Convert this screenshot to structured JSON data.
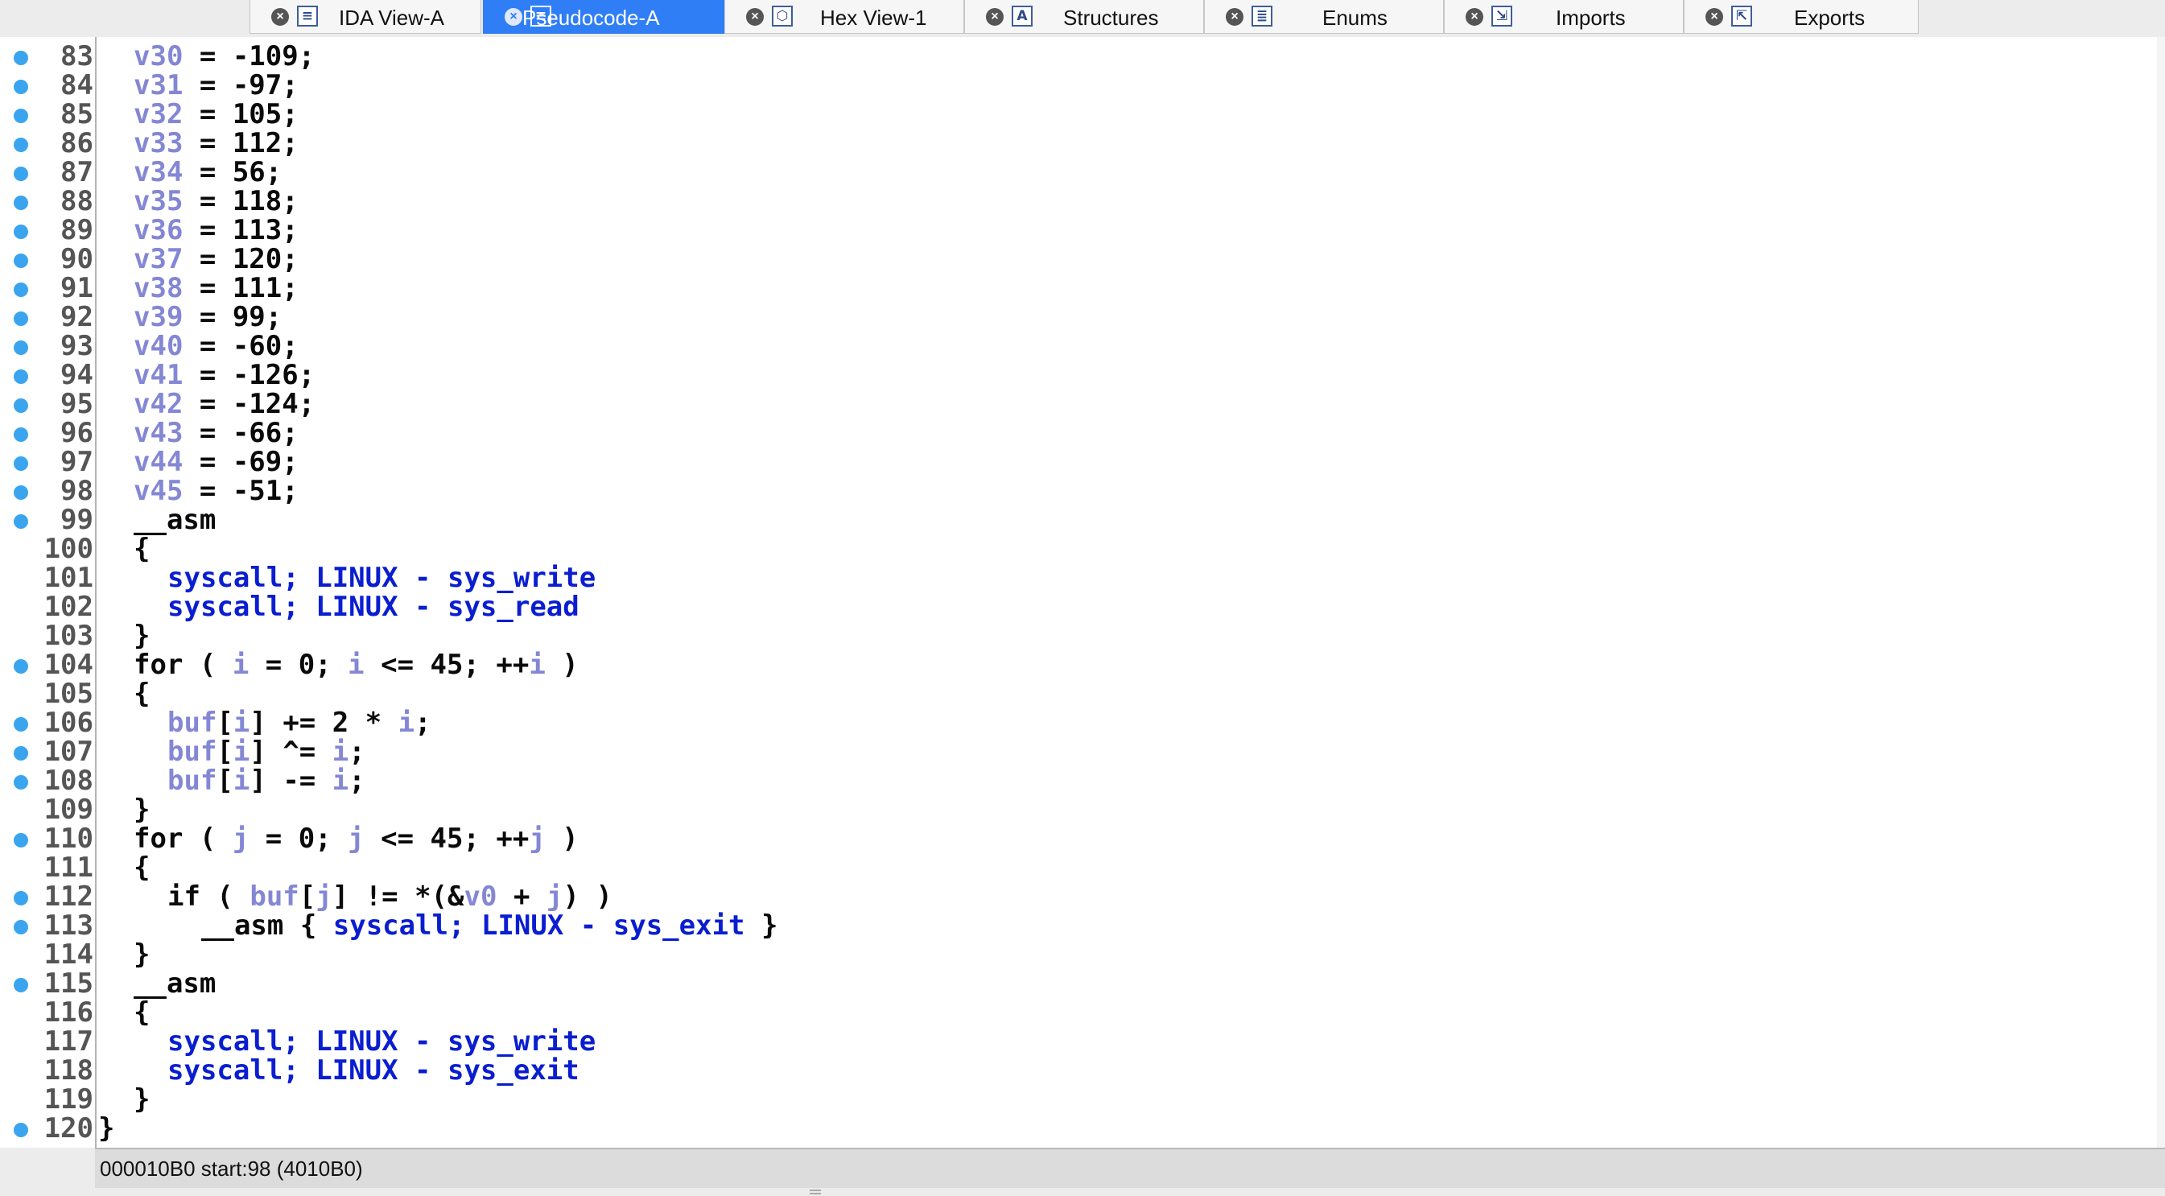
{
  "tabs": [
    {
      "label": "IDA View-A",
      "icon": "disassembly-icon",
      "glyph": "≡",
      "active": false
    },
    {
      "label": "Pseudocode-A",
      "icon": "pseudocode-icon",
      "glyph": "≡",
      "active": true
    },
    {
      "label": "Hex View-1",
      "icon": "hex-icon",
      "glyph": "⬡",
      "active": false
    },
    {
      "label": "Structures",
      "icon": "structures-icon",
      "glyph": "A",
      "active": false
    },
    {
      "label": "Enums",
      "icon": "enums-icon",
      "glyph": "≣",
      "active": false
    },
    {
      "label": "Imports",
      "icon": "imports-icon",
      "glyph": "⇲",
      "active": false
    },
    {
      "label": "Exports",
      "icon": "exports-icon",
      "glyph": "⇱",
      "active": false
    }
  ],
  "colors": {
    "variable": "#8487d4",
    "asm_text": "#0a1ed0",
    "breakpoint_dot": "#3aa5ee",
    "active_tab": "#2f7ef6"
  },
  "lines": [
    {
      "n": "83",
      "dot": true,
      "indent": 1,
      "segs": [
        [
          "v30",
          "var"
        ],
        [
          " = -109;",
          ""
        ]
      ]
    },
    {
      "n": "84",
      "dot": true,
      "indent": 1,
      "segs": [
        [
          "v31",
          "var"
        ],
        [
          " = -97;",
          ""
        ]
      ]
    },
    {
      "n": "85",
      "dot": true,
      "indent": 1,
      "segs": [
        [
          "v32",
          "var"
        ],
        [
          " = 105;",
          ""
        ]
      ]
    },
    {
      "n": "86",
      "dot": true,
      "indent": 1,
      "segs": [
        [
          "v33",
          "var"
        ],
        [
          " = 112;",
          ""
        ]
      ]
    },
    {
      "n": "87",
      "dot": true,
      "indent": 1,
      "segs": [
        [
          "v34",
          "var"
        ],
        [
          " = 56;",
          ""
        ]
      ]
    },
    {
      "n": "88",
      "dot": true,
      "indent": 1,
      "segs": [
        [
          "v35",
          "var"
        ],
        [
          " = 118;",
          ""
        ]
      ]
    },
    {
      "n": "89",
      "dot": true,
      "indent": 1,
      "segs": [
        [
          "v36",
          "var"
        ],
        [
          " = 113;",
          ""
        ]
      ]
    },
    {
      "n": "90",
      "dot": true,
      "indent": 1,
      "segs": [
        [
          "v37",
          "var"
        ],
        [
          " = 120;",
          ""
        ]
      ]
    },
    {
      "n": "91",
      "dot": true,
      "indent": 1,
      "segs": [
        [
          "v38",
          "var"
        ],
        [
          " = 111;",
          ""
        ]
      ]
    },
    {
      "n": "92",
      "dot": true,
      "indent": 1,
      "segs": [
        [
          "v39",
          "var"
        ],
        [
          " = 99;",
          ""
        ]
      ]
    },
    {
      "n": "93",
      "dot": true,
      "indent": 1,
      "segs": [
        [
          "v40",
          "var"
        ],
        [
          " = -60;",
          ""
        ]
      ]
    },
    {
      "n": "94",
      "dot": true,
      "indent": 1,
      "segs": [
        [
          "v41",
          "var"
        ],
        [
          " = -126;",
          ""
        ]
      ]
    },
    {
      "n": "95",
      "dot": true,
      "indent": 1,
      "segs": [
        [
          "v42",
          "var"
        ],
        [
          " = -124;",
          ""
        ]
      ]
    },
    {
      "n": "96",
      "dot": true,
      "indent": 1,
      "segs": [
        [
          "v43",
          "var"
        ],
        [
          " = -66;",
          ""
        ]
      ]
    },
    {
      "n": "97",
      "dot": true,
      "indent": 1,
      "segs": [
        [
          "v44",
          "var"
        ],
        [
          " = -69;",
          ""
        ]
      ]
    },
    {
      "n": "98",
      "dot": true,
      "indent": 1,
      "segs": [
        [
          "v45",
          "var"
        ],
        [
          " = -51;",
          ""
        ]
      ]
    },
    {
      "n": "99",
      "dot": true,
      "indent": 1,
      "segs": [
        [
          "__asm",
          ""
        ]
      ]
    },
    {
      "n": "100",
      "dot": false,
      "indent": 1,
      "segs": [
        [
          "{",
          ""
        ]
      ]
    },
    {
      "n": "101",
      "dot": false,
      "indent": 2,
      "segs": [
        [
          "syscall; LINUX - sys_write",
          "asm"
        ]
      ]
    },
    {
      "n": "102",
      "dot": false,
      "indent": 2,
      "segs": [
        [
          "syscall; LINUX - sys_read",
          "asm"
        ]
      ]
    },
    {
      "n": "103",
      "dot": false,
      "indent": 1,
      "segs": [
        [
          "}",
          ""
        ]
      ]
    },
    {
      "n": "104",
      "dot": true,
      "indent": 1,
      "segs": [
        [
          "for ( ",
          ""
        ],
        [
          "i",
          "var"
        ],
        [
          " = 0; ",
          ""
        ],
        [
          "i",
          "var"
        ],
        [
          " <= 45; ++",
          ""
        ],
        [
          "i",
          "var"
        ],
        [
          " )",
          ""
        ]
      ]
    },
    {
      "n": "105",
      "dot": false,
      "indent": 1,
      "segs": [
        [
          "{",
          ""
        ]
      ]
    },
    {
      "n": "106",
      "dot": true,
      "indent": 2,
      "segs": [
        [
          "buf",
          "var"
        ],
        [
          "[",
          ""
        ],
        [
          "i",
          "var"
        ],
        [
          "] += 2 * ",
          ""
        ],
        [
          "i",
          "var"
        ],
        [
          ";",
          ""
        ]
      ]
    },
    {
      "n": "107",
      "dot": true,
      "indent": 2,
      "segs": [
        [
          "buf",
          "var"
        ],
        [
          "[",
          ""
        ],
        [
          "i",
          "var"
        ],
        [
          "] ^= ",
          ""
        ],
        [
          "i",
          "var"
        ],
        [
          ";",
          ""
        ]
      ]
    },
    {
      "n": "108",
      "dot": true,
      "indent": 2,
      "segs": [
        [
          "buf",
          "var"
        ],
        [
          "[",
          ""
        ],
        [
          "i",
          "var"
        ],
        [
          "] -= ",
          ""
        ],
        [
          "i",
          "var"
        ],
        [
          ";",
          ""
        ]
      ]
    },
    {
      "n": "109",
      "dot": false,
      "indent": 1,
      "segs": [
        [
          "}",
          ""
        ]
      ]
    },
    {
      "n": "110",
      "dot": true,
      "indent": 1,
      "segs": [
        [
          "for ( ",
          ""
        ],
        [
          "j",
          "var"
        ],
        [
          " = 0; ",
          ""
        ],
        [
          "j",
          "var"
        ],
        [
          " <= 45; ++",
          ""
        ],
        [
          "j",
          "var"
        ],
        [
          " )",
          ""
        ]
      ]
    },
    {
      "n": "111",
      "dot": false,
      "indent": 1,
      "segs": [
        [
          "{",
          ""
        ]
      ]
    },
    {
      "n": "112",
      "dot": true,
      "indent": 2,
      "segs": [
        [
          "if ( ",
          ""
        ],
        [
          "buf",
          "var"
        ],
        [
          "[",
          ""
        ],
        [
          "j",
          "var"
        ],
        [
          "] != *(&",
          ""
        ],
        [
          "v0",
          "var"
        ],
        [
          " + ",
          ""
        ],
        [
          "j",
          "var"
        ],
        [
          ") )",
          ""
        ]
      ]
    },
    {
      "n": "113",
      "dot": true,
      "indent": 3,
      "segs": [
        [
          "__asm { ",
          ""
        ],
        [
          "syscall; LINUX - sys_exit",
          "asm"
        ],
        [
          " }",
          ""
        ]
      ]
    },
    {
      "n": "114",
      "dot": false,
      "indent": 1,
      "segs": [
        [
          "}",
          ""
        ]
      ]
    },
    {
      "n": "115",
      "dot": true,
      "indent": 1,
      "segs": [
        [
          "__asm",
          ""
        ]
      ]
    },
    {
      "n": "116",
      "dot": false,
      "indent": 1,
      "segs": [
        [
          "{",
          ""
        ]
      ]
    },
    {
      "n": "117",
      "dot": false,
      "indent": 2,
      "segs": [
        [
          "syscall; LINUX - sys_write",
          "asm"
        ]
      ]
    },
    {
      "n": "118",
      "dot": false,
      "indent": 2,
      "segs": [
        [
          "syscall; LINUX - sys_exit",
          "asm"
        ]
      ]
    },
    {
      "n": "119",
      "dot": false,
      "indent": 1,
      "segs": [
        [
          "}",
          ""
        ]
      ]
    },
    {
      "n": "120",
      "dot": true,
      "indent": 0,
      "segs": [
        [
          "}",
          ""
        ]
      ]
    }
  ],
  "status": {
    "text": "000010B0  start:98 (4010B0)"
  }
}
